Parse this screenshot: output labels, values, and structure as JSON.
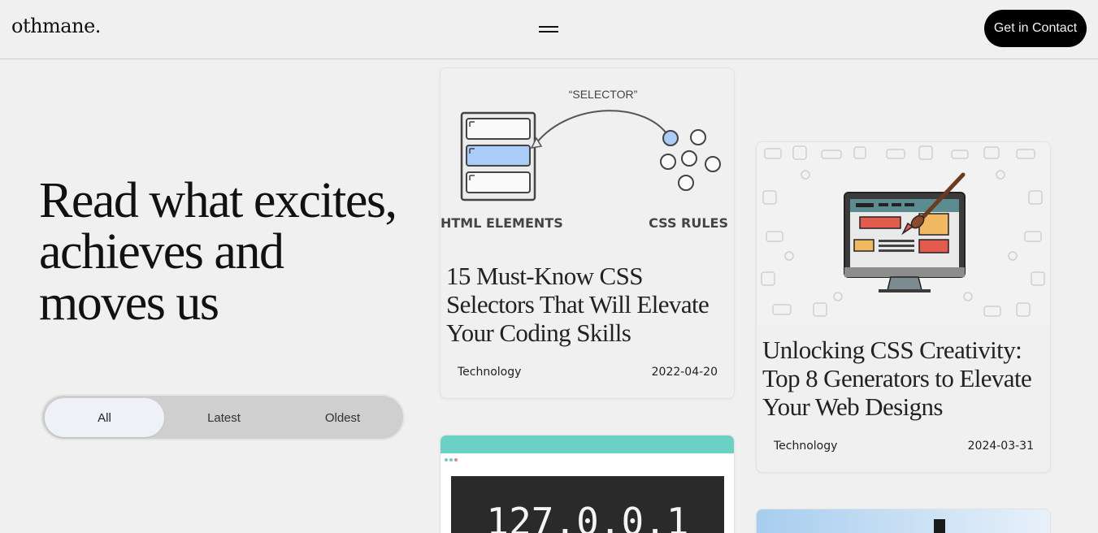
{
  "header": {
    "logo": "othmane.",
    "contact_label": "Get in Contact"
  },
  "hero": {
    "title": "Read what excites, achieves and moves us"
  },
  "filters": [
    {
      "label": "All",
      "active": true
    },
    {
      "label": "Latest",
      "active": false
    },
    {
      "label": "Oldest",
      "active": false
    }
  ],
  "cards": [
    {
      "title": "15 Must-Know CSS Selectors That Will Elevate Your Coding Skills",
      "category": "Technology",
      "date": "2022-04-20",
      "image_labels": {
        "selector": "“SELECTOR”",
        "left": "HTML ELEMENTS",
        "right": "CSS RULES"
      }
    },
    {
      "title": "Unlocking CSS Creativity: Top 8 Generators to Elevate Your Web Designs",
      "category": "Technology",
      "date": "2024-03-31"
    },
    {
      "image_text": "127.0.0.1"
    }
  ],
  "colors": {
    "background": "#f0f0f0",
    "contact_bg": "#000000",
    "highlight_blue": "#a9cdf7",
    "teal": "#6bd1c4"
  }
}
